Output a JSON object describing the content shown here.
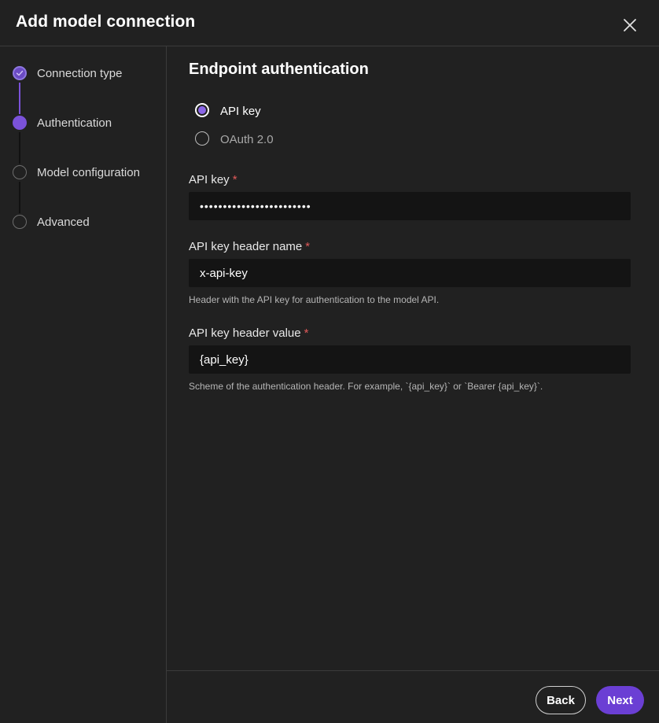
{
  "dialog": {
    "title": "Add model connection",
    "close_icon": "close-icon"
  },
  "steps": [
    {
      "label": "Connection type",
      "state": "completed",
      "icon": "check-icon"
    },
    {
      "label": "Authentication",
      "state": "active"
    },
    {
      "label": "Model configuration",
      "state": "pending"
    },
    {
      "label": "Advanced",
      "state": "pending"
    }
  ],
  "main": {
    "section_title": "Endpoint authentication",
    "auth_options": [
      {
        "label": "API key",
        "selected": true
      },
      {
        "label": "OAuth 2.0",
        "selected": false
      }
    ],
    "fields": {
      "api_key": {
        "label": "API key",
        "required_mark": "*",
        "value": "••••••••••••••••••••••••"
      },
      "header_name": {
        "label": "API key header name",
        "required_mark": "*",
        "value": "x-api-key",
        "helper": "Header with the API key for authentication to the model API."
      },
      "header_value": {
        "label": "API key header value",
        "required_mark": "*",
        "value": "{api_key}",
        "helper": "Scheme of the authentication header. For example, `{api_key}` or `Bearer {api_key}`."
      }
    }
  },
  "footer": {
    "back_label": "Back",
    "next_label": "Next"
  },
  "colors": {
    "accent": "#7b52d9",
    "primary_button": "#6b3fd4",
    "background": "#212121",
    "input_background": "#141414",
    "required": "#e05a5a"
  }
}
